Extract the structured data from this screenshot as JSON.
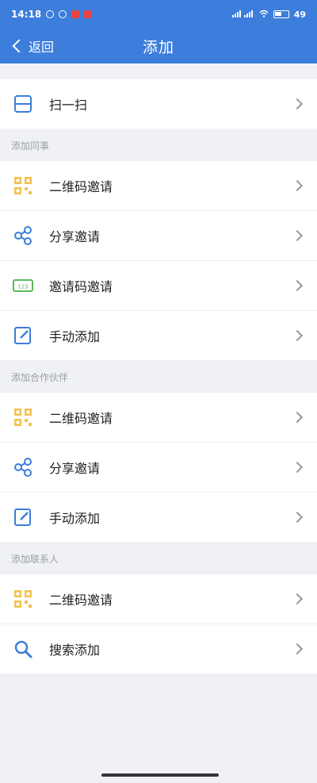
{
  "status": {
    "time": "14:18",
    "battery": "49"
  },
  "nav": {
    "back_label": "返回",
    "title": "添加"
  },
  "scan": {
    "label": "扫一扫",
    "icon": "scan-icon"
  },
  "sections": [
    {
      "header": "添加同事",
      "items": [
        {
          "label": "二维码邀请",
          "icon": "qrcode-icon"
        },
        {
          "label": "分享邀请",
          "icon": "share-icon"
        },
        {
          "label": "邀请码邀请",
          "icon": "invite-code-icon"
        },
        {
          "label": "手动添加",
          "icon": "edit-icon"
        }
      ]
    },
    {
      "header": "添加合作伙伴",
      "items": [
        {
          "label": "二维码邀请",
          "icon": "qrcode-icon"
        },
        {
          "label": "分享邀请",
          "icon": "share-icon"
        },
        {
          "label": "手动添加",
          "icon": "edit-icon"
        }
      ]
    },
    {
      "header": "添加联系人",
      "items": [
        {
          "label": "二维码邀请",
          "icon": "qrcode-icon"
        },
        {
          "label": "搜索添加",
          "icon": "search-icon"
        }
      ]
    }
  ],
  "colors": {
    "primary": "#3d7ddb",
    "qr": "#f2c14e",
    "code": "#5cb85c"
  }
}
